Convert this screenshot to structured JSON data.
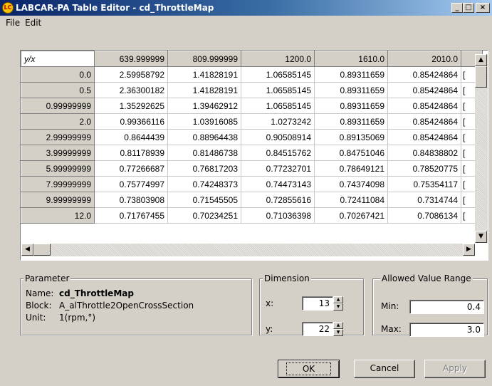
{
  "window": {
    "title": "LABCAR-PA Table Editor - cd_ThrottleMap",
    "icon_text": "LC",
    "controls": {
      "minimize": "_",
      "maximize": "□",
      "close": "×"
    }
  },
  "menu": [
    "File",
    "Edit"
  ],
  "grid": {
    "corner_label": "y/x",
    "columns": [
      "639.999999",
      "809.999999",
      "1200.0",
      "1610.0",
      "2010.0"
    ],
    "clipped_column_glyph": "[",
    "rows": [
      {
        "y": "0.0",
        "values": [
          "2.59958792",
          "1.41828191",
          "1.06585145",
          "0.89311659",
          "0.85424864"
        ]
      },
      {
        "y": "0.5",
        "values": [
          "2.36300182",
          "1.41828191",
          "1.06585145",
          "0.89311659",
          "0.85424864"
        ]
      },
      {
        "y": "0.99999999",
        "values": [
          "1.35292625",
          "1.39462912",
          "1.06585145",
          "0.89311659",
          "0.85424864"
        ]
      },
      {
        "y": "2.0",
        "values": [
          "0.99366116",
          "1.03916085",
          "1.0273242",
          "0.89311659",
          "0.85424864"
        ]
      },
      {
        "y": "2.99999999",
        "values": [
          "0.8644439",
          "0.88964438",
          "0.90508914",
          "0.89135069",
          "0.85424864"
        ]
      },
      {
        "y": "3.99999999",
        "values": [
          "0.81178939",
          "0.81486738",
          "0.84515762",
          "0.84751046",
          "0.84838802"
        ]
      },
      {
        "y": "5.99999999",
        "values": [
          "0.77266687",
          "0.76817203",
          "0.77232701",
          "0.78649121",
          "0.78520775"
        ]
      },
      {
        "y": "7.99999999",
        "values": [
          "0.75774997",
          "0.74248373",
          "0.74473143",
          "0.74374098",
          "0.75354117"
        ]
      },
      {
        "y": "9.99999999",
        "values": [
          "0.73803908",
          "0.71545505",
          "0.72855616",
          "0.72411084",
          "0.7314744"
        ]
      },
      {
        "y": "12.0",
        "values": [
          "0.71767455",
          "0.70234251",
          "0.71036398",
          "0.70267421",
          "0.7086134"
        ]
      }
    ]
  },
  "parameter": {
    "legend": "Parameter",
    "name_label": "Name:",
    "name": "cd_ThrottleMap",
    "block_label": "Block:",
    "block": "A_alThrottle2OpenCrossSection",
    "unit_label": "Unit:",
    "unit": "1(rpm,°)"
  },
  "dimension": {
    "legend": "Dimension",
    "x_label": "x:",
    "x": "13",
    "y_label": "y:",
    "y": "22"
  },
  "range": {
    "legend": "Allowed Value Range",
    "min_label": "Min:",
    "min": "0.4",
    "max_label": "Max:",
    "max": "3.0"
  },
  "buttons": {
    "ok": "OK",
    "cancel": "Cancel",
    "apply": "Apply"
  },
  "icons": {
    "scroll_up": "▲",
    "scroll_down": "▼",
    "scroll_left": "◀",
    "scroll_right": "▶"
  }
}
